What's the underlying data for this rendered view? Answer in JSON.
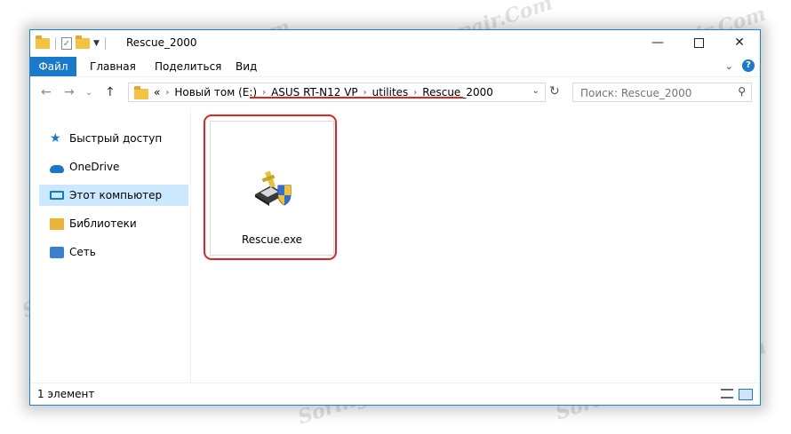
{
  "window": {
    "title": "Rescue_2000"
  },
  "ribbon": {
    "tabs": [
      "Файл",
      "Главная",
      "Поделиться",
      "Вид"
    ]
  },
  "address": {
    "overflow": "«",
    "crumbs": [
      "Новый том (E:)",
      "ASUS RT-N12 VP",
      "utilites",
      "Rescue_2000"
    ]
  },
  "search": {
    "placeholder": "Поиск: Rescue_2000"
  },
  "sidebar": {
    "items": [
      {
        "label": "Быстрый доступ",
        "icon": "star-icon"
      },
      {
        "label": "OneDrive",
        "icon": "cloud-icon"
      },
      {
        "label": "Этот компьютер",
        "icon": "computer-icon",
        "selected": true
      },
      {
        "label": "Библиотеки",
        "icon": "libraries-icon"
      },
      {
        "label": "Сеть",
        "icon": "network-icon"
      }
    ]
  },
  "files": [
    {
      "name": "Rescue.exe",
      "icon": "installer-shield-icon"
    }
  ],
  "status": {
    "count": "1 элемент"
  },
  "watermark": "Soringpcrepair.Com",
  "colors": {
    "accent": "#1979ca",
    "highlight": "#e02424",
    "selected": "#cce8ff"
  }
}
